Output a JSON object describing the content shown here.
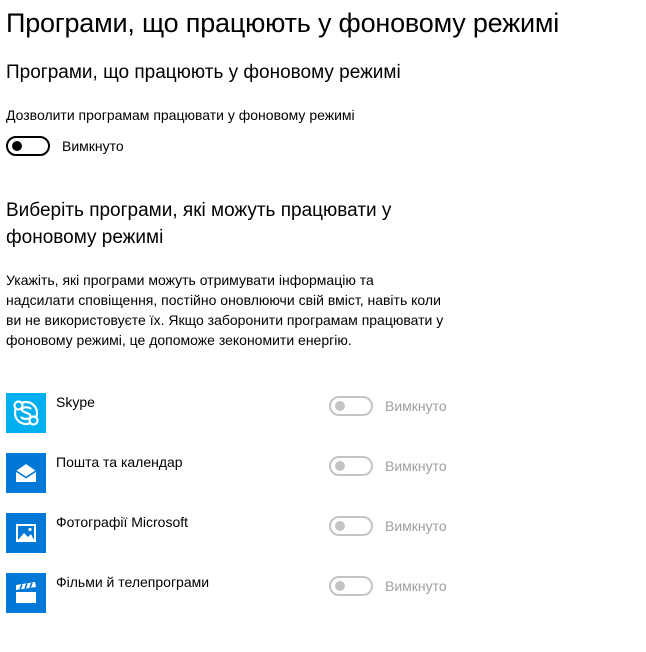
{
  "page": {
    "title": "Програми, що працюють у фоновому режимі"
  },
  "background_apps": {
    "section_title": "Програми, що працюють у фоновому режимі",
    "toggle_label": "Дозволити програмам працювати у фоновому режимі",
    "toggle_on": false,
    "toggle_state": "Вимкнуто"
  },
  "choose_apps": {
    "section_title": "Виберіть програми, які можуть працювати у фоновому режимі",
    "description": "Укажіть, які програми можуть отримувати інформацію та надсилати сповіщення, постійно оновлюючи свій вміст, навіть коли ви не використовуєте їх. Якщо заборонити програмам працювати у фоновому режимі, це допоможе зекономити енергію.",
    "apps": [
      {
        "name": "Skype",
        "icon": "skype-icon",
        "toggle_on": false,
        "toggle_enabled": false,
        "toggle_state": "Вимкнуто",
        "icon_color": "#00aff0"
      },
      {
        "name": "Пошта та календар",
        "icon": "mail-icon",
        "toggle_on": false,
        "toggle_enabled": false,
        "toggle_state": "Вимкнуто",
        "icon_color": "#0078d7"
      },
      {
        "name": "Фотографії Microsoft",
        "icon": "photos-icon",
        "toggle_on": false,
        "toggle_enabled": false,
        "toggle_state": "Вимкнуто",
        "icon_color": "#0078d7"
      },
      {
        "name": "Фільми й телепрограми",
        "icon": "movies-tv-icon",
        "toggle_on": false,
        "toggle_enabled": false,
        "toggle_state": "Вимкнуто",
        "icon_color": "#0078d7"
      }
    ]
  },
  "colors": {
    "accent": "#0078d7",
    "skype": "#00aff0",
    "disabled": "#c4c4c4",
    "disabled_text": "#a0a0a0"
  }
}
